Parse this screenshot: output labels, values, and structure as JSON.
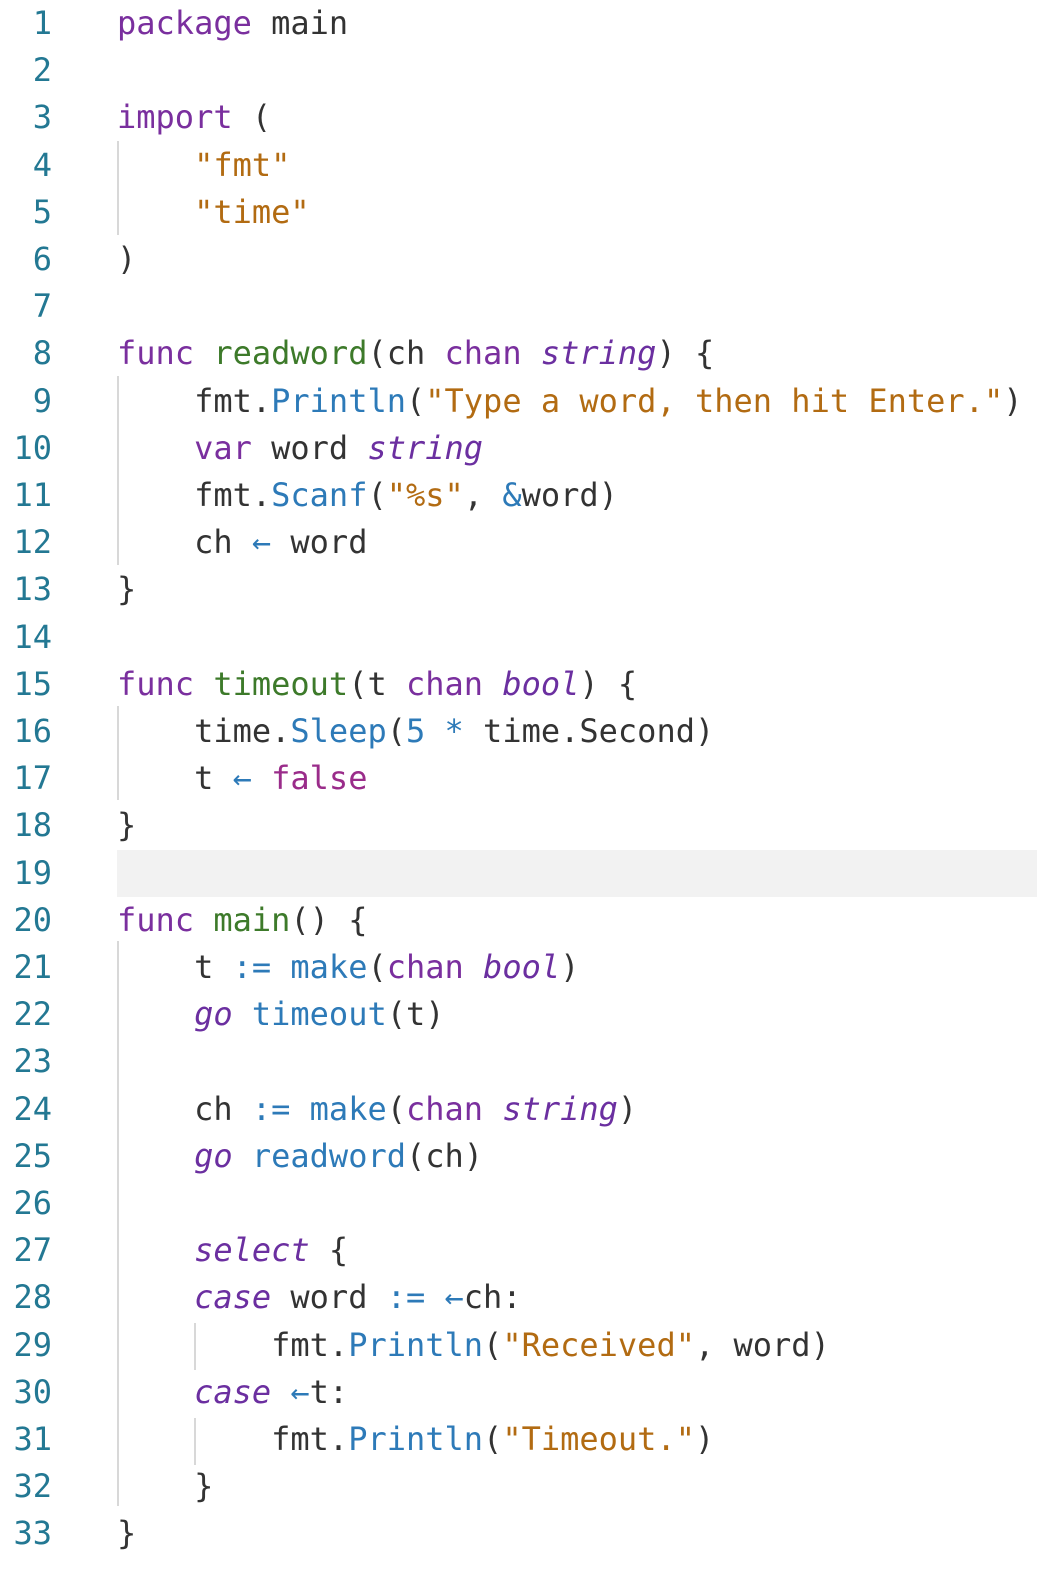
{
  "editor": {
    "language": "go",
    "current_line": 19,
    "colors": {
      "background": "#ffffff",
      "line_number": "#237893",
      "current_line_highlight": "#f2f2f2",
      "keyword": "#7a2f9e",
      "function_name": "#3d7a2a",
      "call": "#2d7ab8",
      "string": "#b26b12",
      "type_italic": "#6b2fa0",
      "constant": "#9a2c8a",
      "plain": "#333333",
      "indent_guide": "#d8d8d8"
    },
    "lines": [
      {
        "n": "1",
        "tokens": [
          {
            "t": "kw",
            "v": "package"
          },
          {
            "t": "pl",
            "v": " main"
          }
        ]
      },
      {
        "n": "2",
        "tokens": []
      },
      {
        "n": "3",
        "tokens": [
          {
            "t": "kw",
            "v": "import"
          },
          {
            "t": "pl",
            "v": " ("
          }
        ]
      },
      {
        "n": "4",
        "tokens": [
          {
            "t": "pl",
            "v": "    "
          },
          {
            "t": "str",
            "v": "\"fmt\""
          }
        ]
      },
      {
        "n": "5",
        "tokens": [
          {
            "t": "pl",
            "v": "    "
          },
          {
            "t": "str",
            "v": "\"time\""
          }
        ]
      },
      {
        "n": "6",
        "tokens": [
          {
            "t": "pl",
            "v": ")"
          }
        ]
      },
      {
        "n": "7",
        "tokens": []
      },
      {
        "n": "8",
        "tokens": [
          {
            "t": "kw",
            "v": "func"
          },
          {
            "t": "pl",
            "v": " "
          },
          {
            "t": "fn",
            "v": "readword"
          },
          {
            "t": "pl",
            "v": "(ch "
          },
          {
            "t": "kw",
            "v": "chan"
          },
          {
            "t": "pl",
            "v": " "
          },
          {
            "t": "type",
            "v": "string"
          },
          {
            "t": "pl",
            "v": ") {"
          }
        ]
      },
      {
        "n": "9",
        "tokens": [
          {
            "t": "pl",
            "v": "    fmt."
          },
          {
            "t": "call",
            "v": "Println"
          },
          {
            "t": "pl",
            "v": "("
          },
          {
            "t": "str",
            "v": "\"Type a word, then hit Enter.\""
          },
          {
            "t": "pl",
            "v": ")"
          }
        ]
      },
      {
        "n": "10",
        "tokens": [
          {
            "t": "pl",
            "v": "    "
          },
          {
            "t": "kw",
            "v": "var"
          },
          {
            "t": "pl",
            "v": " word "
          },
          {
            "t": "type",
            "v": "string"
          }
        ]
      },
      {
        "n": "11",
        "tokens": [
          {
            "t": "pl",
            "v": "    fmt."
          },
          {
            "t": "call",
            "v": "Scanf"
          },
          {
            "t": "pl",
            "v": "("
          },
          {
            "t": "str",
            "v": "\"%s\""
          },
          {
            "t": "pl",
            "v": ", "
          },
          {
            "t": "op",
            "v": "&"
          },
          {
            "t": "pl",
            "v": "word)"
          }
        ]
      },
      {
        "n": "12",
        "tokens": [
          {
            "t": "pl",
            "v": "    ch "
          },
          {
            "t": "op",
            "v": "←"
          },
          {
            "t": "pl",
            "v": " word"
          }
        ]
      },
      {
        "n": "13",
        "tokens": [
          {
            "t": "pl",
            "v": "}"
          }
        ]
      },
      {
        "n": "14",
        "tokens": []
      },
      {
        "n": "15",
        "tokens": [
          {
            "t": "kw",
            "v": "func"
          },
          {
            "t": "pl",
            "v": " "
          },
          {
            "t": "fn",
            "v": "timeout"
          },
          {
            "t": "pl",
            "v": "(t "
          },
          {
            "t": "kw",
            "v": "chan"
          },
          {
            "t": "pl",
            "v": " "
          },
          {
            "t": "type",
            "v": "bool"
          },
          {
            "t": "pl",
            "v": ") {"
          }
        ]
      },
      {
        "n": "16",
        "tokens": [
          {
            "t": "pl",
            "v": "    time."
          },
          {
            "t": "call",
            "v": "Sleep"
          },
          {
            "t": "pl",
            "v": "("
          },
          {
            "t": "num",
            "v": "5"
          },
          {
            "t": "pl",
            "v": " "
          },
          {
            "t": "op",
            "v": "*"
          },
          {
            "t": "pl",
            "v": " time.Second)"
          }
        ]
      },
      {
        "n": "17",
        "tokens": [
          {
            "t": "pl",
            "v": "    t "
          },
          {
            "t": "op",
            "v": "←"
          },
          {
            "t": "pl",
            "v": " "
          },
          {
            "t": "const",
            "v": "false"
          }
        ]
      },
      {
        "n": "18",
        "tokens": [
          {
            "t": "pl",
            "v": "}"
          }
        ]
      },
      {
        "n": "19",
        "tokens": []
      },
      {
        "n": "20",
        "tokens": [
          {
            "t": "kw",
            "v": "func"
          },
          {
            "t": "pl",
            "v": " "
          },
          {
            "t": "fn",
            "v": "main"
          },
          {
            "t": "pl",
            "v": "() {"
          }
        ]
      },
      {
        "n": "21",
        "tokens": [
          {
            "t": "pl",
            "v": "    t "
          },
          {
            "t": "op",
            "v": ":="
          },
          {
            "t": "pl",
            "v": " "
          },
          {
            "t": "call",
            "v": "make"
          },
          {
            "t": "pl",
            "v": "("
          },
          {
            "t": "kw",
            "v": "chan"
          },
          {
            "t": "pl",
            "v": " "
          },
          {
            "t": "type",
            "v": "bool"
          },
          {
            "t": "pl",
            "v": ")"
          }
        ]
      },
      {
        "n": "22",
        "tokens": [
          {
            "t": "pl",
            "v": "    "
          },
          {
            "t": "it",
            "v": "go"
          },
          {
            "t": "pl",
            "v": " "
          },
          {
            "t": "call",
            "v": "timeout"
          },
          {
            "t": "pl",
            "v": "(t)"
          }
        ]
      },
      {
        "n": "23",
        "tokens": []
      },
      {
        "n": "24",
        "tokens": [
          {
            "t": "pl",
            "v": "    ch "
          },
          {
            "t": "op",
            "v": ":="
          },
          {
            "t": "pl",
            "v": " "
          },
          {
            "t": "call",
            "v": "make"
          },
          {
            "t": "pl",
            "v": "("
          },
          {
            "t": "kw",
            "v": "chan"
          },
          {
            "t": "pl",
            "v": " "
          },
          {
            "t": "type",
            "v": "string"
          },
          {
            "t": "pl",
            "v": ")"
          }
        ]
      },
      {
        "n": "25",
        "tokens": [
          {
            "t": "pl",
            "v": "    "
          },
          {
            "t": "it",
            "v": "go"
          },
          {
            "t": "pl",
            "v": " "
          },
          {
            "t": "call",
            "v": "readword"
          },
          {
            "t": "pl",
            "v": "(ch)"
          }
        ]
      },
      {
        "n": "26",
        "tokens": []
      },
      {
        "n": "27",
        "tokens": [
          {
            "t": "pl",
            "v": "    "
          },
          {
            "t": "it",
            "v": "select"
          },
          {
            "t": "pl",
            "v": " {"
          }
        ]
      },
      {
        "n": "28",
        "tokens": [
          {
            "t": "pl",
            "v": "    "
          },
          {
            "t": "it",
            "v": "case"
          },
          {
            "t": "pl",
            "v": " word "
          },
          {
            "t": "op",
            "v": ":="
          },
          {
            "t": "pl",
            "v": " "
          },
          {
            "t": "op",
            "v": "←"
          },
          {
            "t": "pl",
            "v": "ch:"
          }
        ]
      },
      {
        "n": "29",
        "tokens": [
          {
            "t": "pl",
            "v": "        fmt."
          },
          {
            "t": "call",
            "v": "Println"
          },
          {
            "t": "pl",
            "v": "("
          },
          {
            "t": "str",
            "v": "\"Received\""
          },
          {
            "t": "pl",
            "v": ", word)"
          }
        ]
      },
      {
        "n": "30",
        "tokens": [
          {
            "t": "pl",
            "v": "    "
          },
          {
            "t": "it",
            "v": "case"
          },
          {
            "t": "pl",
            "v": " "
          },
          {
            "t": "op",
            "v": "←"
          },
          {
            "t": "pl",
            "v": "t:"
          }
        ]
      },
      {
        "n": "31",
        "tokens": [
          {
            "t": "pl",
            "v": "        fmt."
          },
          {
            "t": "call",
            "v": "Println"
          },
          {
            "t": "pl",
            "v": "("
          },
          {
            "t": "str",
            "v": "\"Timeout.\""
          },
          {
            "t": "pl",
            "v": ")"
          }
        ]
      },
      {
        "n": "32",
        "tokens": [
          {
            "t": "pl",
            "v": "    }"
          }
        ]
      },
      {
        "n": "33",
        "tokens": [
          {
            "t": "pl",
            "v": "}"
          }
        ]
      }
    ]
  }
}
